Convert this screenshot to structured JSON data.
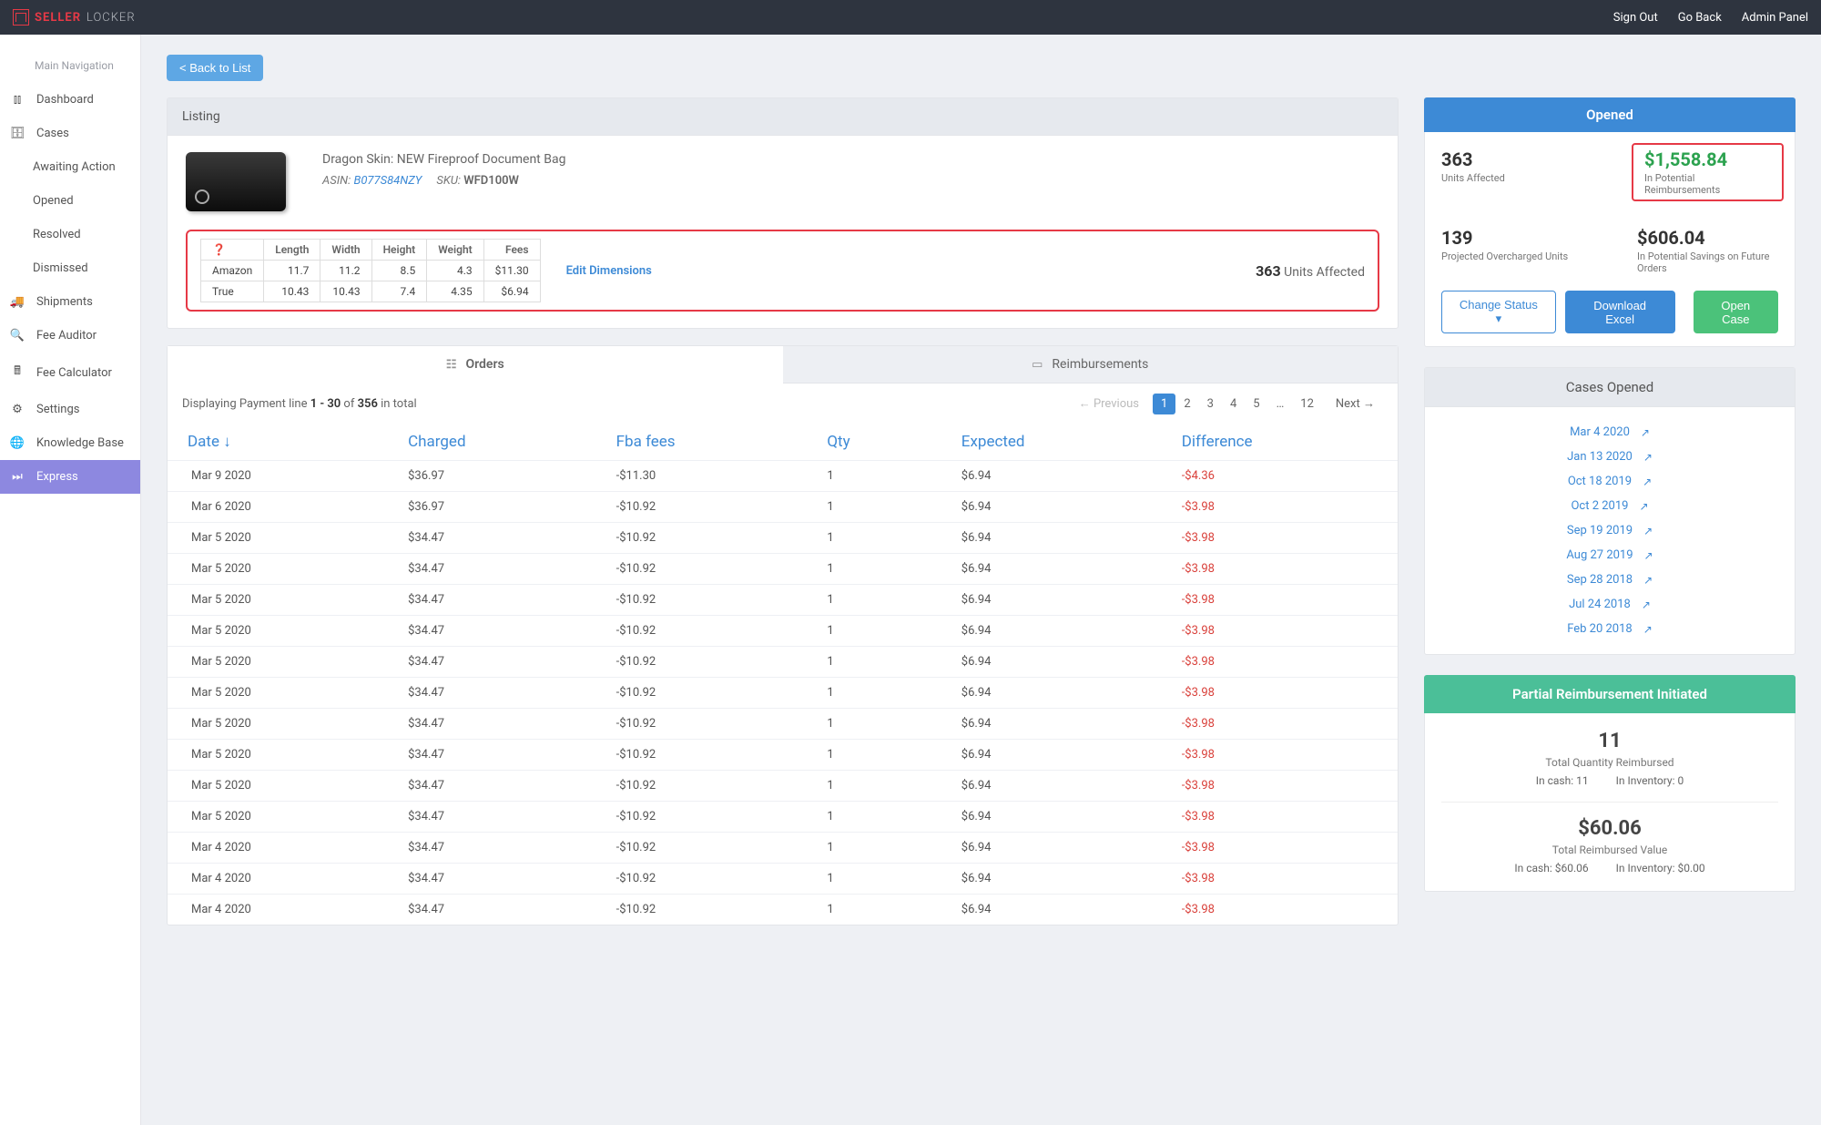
{
  "header": {
    "brand1": "SELLER",
    "brand2": "LOCKER",
    "links": [
      "Sign Out",
      "Go Back",
      "Admin Panel"
    ]
  },
  "sidebar": {
    "heading": "Main Navigation",
    "items": [
      {
        "label": "Dashboard",
        "icon": "bars"
      },
      {
        "label": "Cases",
        "icon": "briefcase"
      },
      {
        "label": "Awaiting Action",
        "sub": true
      },
      {
        "label": "Opened",
        "sub": true
      },
      {
        "label": "Resolved",
        "sub": true
      },
      {
        "label": "Dismissed",
        "sub": true
      },
      {
        "label": "Shipments",
        "icon": "truck"
      },
      {
        "label": "Fee Auditor",
        "icon": "search"
      },
      {
        "label": "Fee Calculator",
        "icon": "calc"
      },
      {
        "label": "Settings",
        "icon": "gear"
      },
      {
        "label": "Knowledge Base",
        "icon": "globe"
      },
      {
        "label": "Express",
        "icon": "fwd",
        "active": true
      }
    ]
  },
  "back_button": "< Back to List",
  "listing": {
    "header": "Listing",
    "title": "Dragon Skin: NEW Fireproof Document Bag",
    "asin_label": "ASIN:",
    "asin": "B077S84NZY",
    "sku_label": "SKU:",
    "sku": "WFD100W",
    "dim_headers": [
      "",
      "Length",
      "Width",
      "Height",
      "Weight",
      "Fees"
    ],
    "dim_rows": [
      {
        "label": "Amazon",
        "length": "11.7",
        "width": "11.2",
        "height": "8.5",
        "weight": "4.3",
        "fees": "$11.30"
      },
      {
        "label": "True",
        "length": "10.43",
        "width": "10.43",
        "height": "7.4",
        "weight": "4.35",
        "fees": "$6.94"
      }
    ],
    "edit_link": "Edit Dimensions",
    "units_affected_count": "363",
    "units_affected_label": "Units Affected"
  },
  "opened": {
    "header": "Opened",
    "units_affected": "363",
    "units_affected_label": "Units Affected",
    "potential_reimb": "$1,558.84",
    "potential_reimb_label": "In Potential Reimbursements",
    "projected_units": "139",
    "projected_units_label": "Projected Overcharged Units",
    "savings": "$606.04",
    "savings_label": "In Potential Savings on Future Orders",
    "btn_status": "Change Status",
    "btn_download": "Download Excel",
    "btn_open": "Open Case"
  },
  "cases_opened": {
    "header": "Cases Opened",
    "list": [
      "Mar 4 2020",
      "Jan 13 2020",
      "Oct 18 2019",
      "Oct 2 2019",
      "Sep 19 2019",
      "Aug 27 2019",
      "Sep 28 2018",
      "Jul 24 2018",
      "Feb 20 2018"
    ]
  },
  "partial": {
    "header": "Partial Reimbursement Initiated",
    "qty": "11",
    "qty_label": "Total Quantity Reimbursed",
    "qty_cash": "In cash: 11",
    "qty_inv": "In Inventory: 0",
    "amount": "$60.06",
    "amount_label": "Total Reimbursed Value",
    "amount_cash": "In cash: $60.06",
    "amount_inv": "In Inventory: $0.00"
  },
  "orders": {
    "tabs": [
      "Orders",
      "Reimbursements"
    ],
    "display_prefix": "Displaying Payment line ",
    "range": "1 - 30",
    "of_text": " of ",
    "total": "356",
    "suffix": " in total",
    "prev": "← Previous",
    "pages": [
      "1",
      "2",
      "3",
      "4",
      "5",
      "…",
      "12"
    ],
    "next": "Next →",
    "columns": [
      "Date",
      "Charged",
      "Fba fees",
      "Qty",
      "Expected",
      "Difference"
    ],
    "rows": [
      {
        "date": "Mar 9 2020",
        "charged": "$36.97",
        "fba": "-$11.30",
        "qty": "1",
        "exp": "$6.94",
        "diff": "-$4.36"
      },
      {
        "date": "Mar 6 2020",
        "charged": "$36.97",
        "fba": "-$10.92",
        "qty": "1",
        "exp": "$6.94",
        "diff": "-$3.98"
      },
      {
        "date": "Mar 5 2020",
        "charged": "$34.47",
        "fba": "-$10.92",
        "qty": "1",
        "exp": "$6.94",
        "diff": "-$3.98"
      },
      {
        "date": "Mar 5 2020",
        "charged": "$34.47",
        "fba": "-$10.92",
        "qty": "1",
        "exp": "$6.94",
        "diff": "-$3.98"
      },
      {
        "date": "Mar 5 2020",
        "charged": "$34.47",
        "fba": "-$10.92",
        "qty": "1",
        "exp": "$6.94",
        "diff": "-$3.98"
      },
      {
        "date": "Mar 5 2020",
        "charged": "$34.47",
        "fba": "-$10.92",
        "qty": "1",
        "exp": "$6.94",
        "diff": "-$3.98"
      },
      {
        "date": "Mar 5 2020",
        "charged": "$34.47",
        "fba": "-$10.92",
        "qty": "1",
        "exp": "$6.94",
        "diff": "-$3.98"
      },
      {
        "date": "Mar 5 2020",
        "charged": "$34.47",
        "fba": "-$10.92",
        "qty": "1",
        "exp": "$6.94",
        "diff": "-$3.98"
      },
      {
        "date": "Mar 5 2020",
        "charged": "$34.47",
        "fba": "-$10.92",
        "qty": "1",
        "exp": "$6.94",
        "diff": "-$3.98"
      },
      {
        "date": "Mar 5 2020",
        "charged": "$34.47",
        "fba": "-$10.92",
        "qty": "1",
        "exp": "$6.94",
        "diff": "-$3.98"
      },
      {
        "date": "Mar 5 2020",
        "charged": "$34.47",
        "fba": "-$10.92",
        "qty": "1",
        "exp": "$6.94",
        "diff": "-$3.98"
      },
      {
        "date": "Mar 5 2020",
        "charged": "$34.47",
        "fba": "-$10.92",
        "qty": "1",
        "exp": "$6.94",
        "diff": "-$3.98"
      },
      {
        "date": "Mar 4 2020",
        "charged": "$34.47",
        "fba": "-$10.92",
        "qty": "1",
        "exp": "$6.94",
        "diff": "-$3.98"
      },
      {
        "date": "Mar 4 2020",
        "charged": "$34.47",
        "fba": "-$10.92",
        "qty": "1",
        "exp": "$6.94",
        "diff": "-$3.98"
      },
      {
        "date": "Mar 4 2020",
        "charged": "$34.47",
        "fba": "-$10.92",
        "qty": "1",
        "exp": "$6.94",
        "diff": "-$3.98"
      }
    ]
  }
}
